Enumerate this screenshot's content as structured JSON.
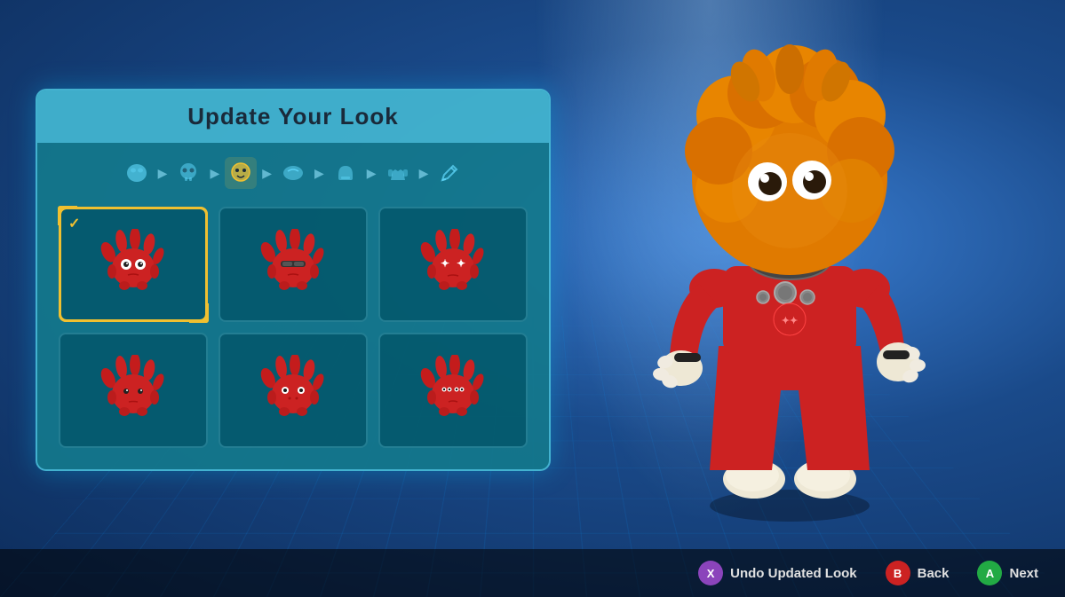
{
  "panel": {
    "title": "Update Your Look"
  },
  "steps": [
    {
      "icon": "👤",
      "active": false
    },
    {
      "icon": "💀",
      "active": false
    },
    {
      "icon": "😊",
      "active": true
    },
    {
      "icon": "🎭",
      "active": false
    },
    {
      "icon": "😷",
      "active": false
    },
    {
      "icon": "👕",
      "active": false
    },
    {
      "icon": "✏️",
      "active": false
    }
  ],
  "creatures": [
    {
      "id": 1,
      "selected": true,
      "face": "normal",
      "label": "Red fuzzy default"
    },
    {
      "id": 2,
      "selected": false,
      "face": "visor",
      "label": "Red fuzzy visor"
    },
    {
      "id": 3,
      "selected": false,
      "face": "sparkle",
      "label": "Red fuzzy sparkle"
    },
    {
      "id": 4,
      "selected": false,
      "face": "sleepy",
      "label": "Red fuzzy sleepy"
    },
    {
      "id": 5,
      "selected": false,
      "face": "dots",
      "label": "Red fuzzy dots"
    },
    {
      "id": 6,
      "selected": false,
      "face": "angry",
      "label": "Red fuzzy angry"
    }
  ],
  "bottom": {
    "undo_label": "Undo Updated Look",
    "back_label": "Back",
    "next_label": "Next",
    "btn_x": "X",
    "btn_b": "B",
    "btn_a": "A"
  }
}
